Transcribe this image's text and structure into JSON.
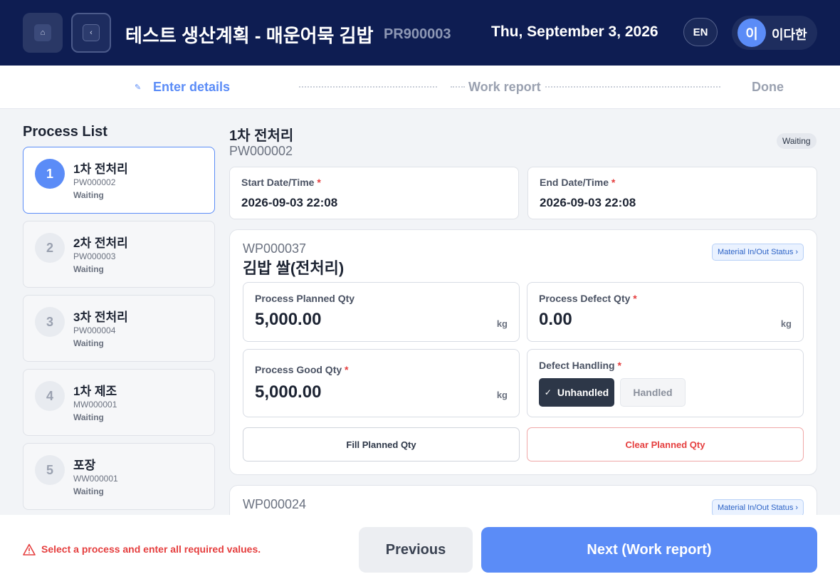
{
  "header": {
    "home_icon": "home-icon",
    "back_icon": "chevron-left-icon",
    "title": "테스트 생산계획 - 매운어묵 김밥",
    "plan_code": "PR900003",
    "date": "Thu, September 3, 2026",
    "lang": "EN",
    "user_initial": "이",
    "user_name": "이다한"
  },
  "stepper": {
    "steps": [
      {
        "label": "Enter details",
        "state": "active"
      },
      {
        "label": "Work report",
        "state": "pending"
      },
      {
        "label": "Done",
        "state": "pending"
      }
    ]
  },
  "process_list": {
    "title": "Process List",
    "items": [
      {
        "num": "1",
        "name": "1차 전처리",
        "code": "PW000002",
        "status": "Waiting",
        "active": true
      },
      {
        "num": "2",
        "name": "2차 전처리",
        "code": "PW000003",
        "status": "Waiting"
      },
      {
        "num": "3",
        "name": "3차 전처리",
        "code": "PW000004",
        "status": "Waiting"
      },
      {
        "num": "4",
        "name": "1차 제조",
        "code": "MW000001",
        "status": "Waiting"
      },
      {
        "num": "5",
        "name": "포장",
        "code": "WW000001",
        "status": "Waiting"
      }
    ]
  },
  "process": {
    "name": "1차 전처리",
    "code": "PW000002",
    "status": "Waiting",
    "start_label": "Start Date/Time",
    "start_value": "2026-09-03 22:08",
    "end_label": "End Date/Time",
    "end_value": "2026-09-03 22:08",
    "required_mark": "*"
  },
  "work_items": [
    {
      "code": "WP000037",
      "name": "김밥 쌀(전처리)",
      "material_btn": "Material In/Out Status ›",
      "planned_label": "Process Planned Qty",
      "planned_value": "5,000.00",
      "defect_label": "Process Defect Qty",
      "defect_value": "0.00",
      "good_label": "Process Good Qty",
      "good_value": "5,000.00",
      "unit": "kg",
      "handling_label": "Defect Handling",
      "handling_options": [
        "Unhandled",
        "Handled"
      ],
      "handling_selected": "Unhandled",
      "fill_btn": "Fill Planned Qty",
      "clear_btn": "Clear Planned Qty"
    },
    {
      "code": "WP000024",
      "name": "",
      "material_btn": "Material In/Out Status ›"
    }
  ],
  "footer": {
    "warning": "Select a process and enter all required values.",
    "prev": "Previous",
    "next": "Next (Work report)"
  },
  "colors": {
    "header_bg": "#0e1d52",
    "accent": "#5b8cf7",
    "error": "#e53e3e"
  }
}
